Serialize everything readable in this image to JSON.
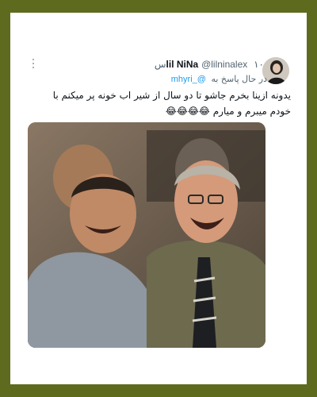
{
  "tweet": {
    "display_name": "lil NiNa",
    "handle": "@lilninalex",
    "time": "۱۰س",
    "reply_prefix": "در حال پاسخ به",
    "reply_to": "@_mhyri",
    "text_line1": "یدونه ازینا بخرم جاشو تا دو سال از شیر اب خونه پر میکنم با",
    "text_line2": "خودم میبرم و میارم 😂😂😂😂",
    "emoji_tail": "😂😂😂😂"
  },
  "icons": {
    "more": "more-dots-icon",
    "avatar": "profile-avatar"
  },
  "colors": {
    "frame_border": "#5e6b1f",
    "card_bg": "#ffffff",
    "link": "#1d9bf0",
    "secondary_text": "#536471",
    "primary_text": "#0f1419"
  }
}
